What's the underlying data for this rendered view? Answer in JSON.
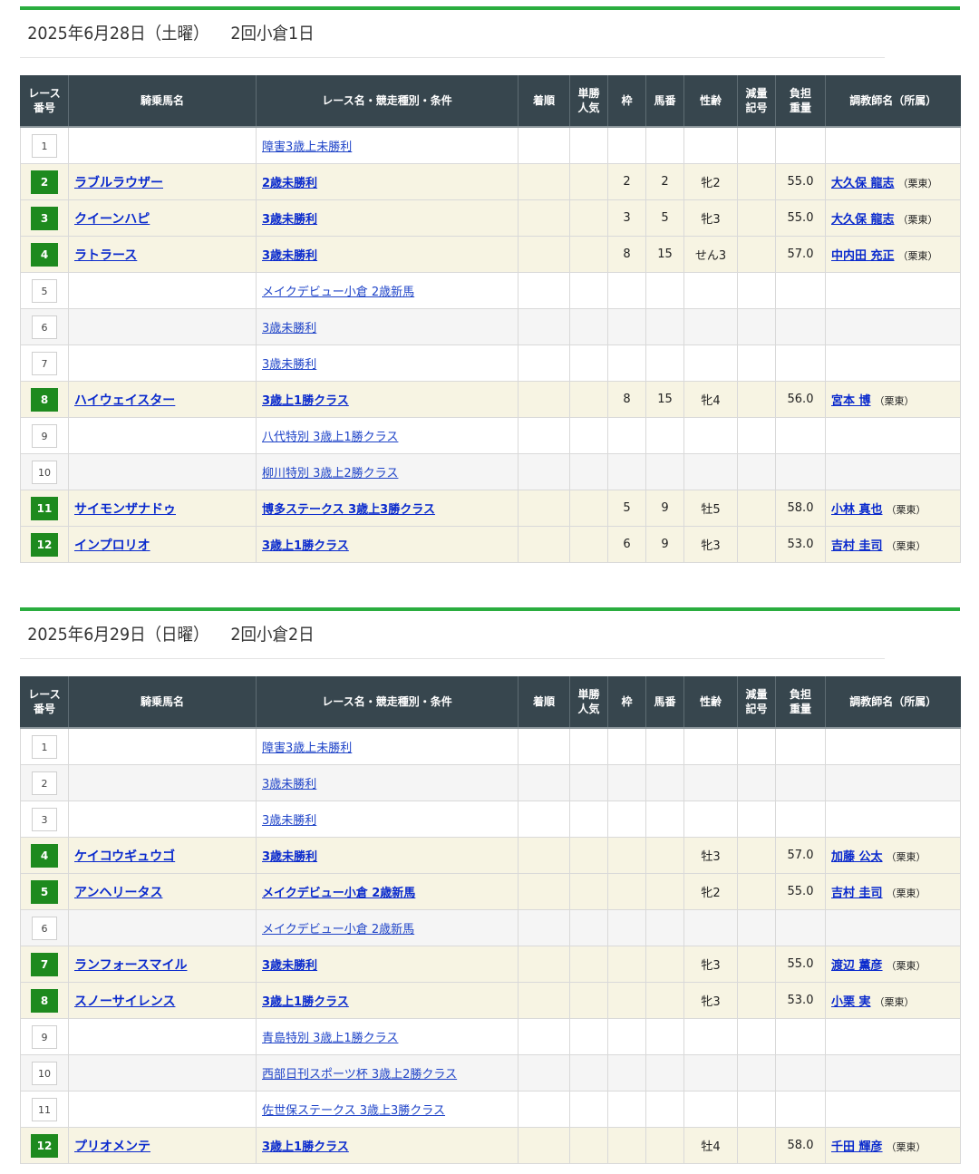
{
  "headers": {
    "race_no": [
      "レース",
      "番号"
    ],
    "jockey_horse": "騎乗馬名",
    "race_name": "レース名・競走種別・条件",
    "finish": "着順",
    "popularity": [
      "単勝",
      "人気"
    ],
    "frame": "枠",
    "horse_no": "馬番",
    "sex_age": "性齢",
    "reduction": [
      "減量",
      "記号"
    ],
    "weight": [
      "負担",
      "重量"
    ],
    "trainer": "調教師名（所属）"
  },
  "days": [
    {
      "date": "2025年6月28日（土曜）",
      "meeting": "2回小倉1日",
      "races": [
        {
          "no": "1",
          "horse": "",
          "race": "障害3歳上未勝利",
          "frame": "",
          "horse_no": "",
          "sex_age": "",
          "weight": "",
          "trainer": "",
          "affiliation": ""
        },
        {
          "no": "2",
          "horse": "ラブルラウザー",
          "race": "2歳未勝利",
          "frame": "2",
          "horse_no": "2",
          "sex_age": "牝2",
          "weight": "55.0",
          "trainer": "大久保 龍志",
          "affiliation": "（栗東）"
        },
        {
          "no": "3",
          "horse": "クイーンハピ",
          "race": "3歳未勝利",
          "frame": "3",
          "horse_no": "5",
          "sex_age": "牝3",
          "weight": "55.0",
          "trainer": "大久保 龍志",
          "affiliation": "（栗東）"
        },
        {
          "no": "4",
          "horse": "ラトラース",
          "race": "3歳未勝利",
          "frame": "8",
          "horse_no": "15",
          "sex_age": "せん3",
          "weight": "57.0",
          "trainer": "中内田 充正",
          "affiliation": "（栗東）"
        },
        {
          "no": "5",
          "horse": "",
          "race": "メイクデビュー小倉 2歳新馬",
          "frame": "",
          "horse_no": "",
          "sex_age": "",
          "weight": "",
          "trainer": "",
          "affiliation": ""
        },
        {
          "no": "6",
          "horse": "",
          "race": "3歳未勝利",
          "frame": "",
          "horse_no": "",
          "sex_age": "",
          "weight": "",
          "trainer": "",
          "affiliation": ""
        },
        {
          "no": "7",
          "horse": "",
          "race": "3歳未勝利",
          "frame": "",
          "horse_no": "",
          "sex_age": "",
          "weight": "",
          "trainer": "",
          "affiliation": ""
        },
        {
          "no": "8",
          "horse": "ハイウェイスター",
          "race": "3歳上1勝クラス",
          "frame": "8",
          "horse_no": "15",
          "sex_age": "牝4",
          "weight": "56.0",
          "trainer": "宮本 博",
          "affiliation": "（栗東）"
        },
        {
          "no": "9",
          "horse": "",
          "race": "八代特別 3歳上1勝クラス",
          "frame": "",
          "horse_no": "",
          "sex_age": "",
          "weight": "",
          "trainer": "",
          "affiliation": ""
        },
        {
          "no": "10",
          "horse": "",
          "race": "柳川特別 3歳上2勝クラス",
          "frame": "",
          "horse_no": "",
          "sex_age": "",
          "weight": "",
          "trainer": "",
          "affiliation": ""
        },
        {
          "no": "11",
          "horse": "サイモンザナドゥ",
          "race": "博多ステークス 3歳上3勝クラス",
          "frame": "5",
          "horse_no": "9",
          "sex_age": "牡5",
          "weight": "58.0",
          "trainer": "小林 真也",
          "affiliation": "（栗東）"
        },
        {
          "no": "12",
          "horse": "インプロリオ",
          "race": "3歳上1勝クラス",
          "frame": "6",
          "horse_no": "9",
          "sex_age": "牝3",
          "weight": "53.0",
          "trainer": "吉村 圭司",
          "affiliation": "（栗東）"
        }
      ]
    },
    {
      "date": "2025年6月29日（日曜）",
      "meeting": "2回小倉2日",
      "races": [
        {
          "no": "1",
          "horse": "",
          "race": "障害3歳上未勝利",
          "frame": "",
          "horse_no": "",
          "sex_age": "",
          "weight": "",
          "trainer": "",
          "affiliation": ""
        },
        {
          "no": "2",
          "horse": "",
          "race": "3歳未勝利",
          "frame": "",
          "horse_no": "",
          "sex_age": "",
          "weight": "",
          "trainer": "",
          "affiliation": ""
        },
        {
          "no": "3",
          "horse": "",
          "race": "3歳未勝利",
          "frame": "",
          "horse_no": "",
          "sex_age": "",
          "weight": "",
          "trainer": "",
          "affiliation": ""
        },
        {
          "no": "4",
          "horse": "ケイコウギュウゴ",
          "race": "3歳未勝利",
          "frame": "",
          "horse_no": "",
          "sex_age": "牡3",
          "weight": "57.0",
          "trainer": "加藤 公太",
          "affiliation": "（栗東）"
        },
        {
          "no": "5",
          "horse": "アンヘリータス",
          "race": "メイクデビュー小倉 2歳新馬",
          "frame": "",
          "horse_no": "",
          "sex_age": "牝2",
          "weight": "55.0",
          "trainer": "吉村 圭司",
          "affiliation": "（栗東）"
        },
        {
          "no": "6",
          "horse": "",
          "race": "メイクデビュー小倉 2歳新馬",
          "frame": "",
          "horse_no": "",
          "sex_age": "",
          "weight": "",
          "trainer": "",
          "affiliation": ""
        },
        {
          "no": "7",
          "horse": "ランフォースマイル",
          "race": "3歳未勝利",
          "frame": "",
          "horse_no": "",
          "sex_age": "牝3",
          "weight": "55.0",
          "trainer": "渡辺 薫彦",
          "affiliation": "（栗東）"
        },
        {
          "no": "8",
          "horse": "スノーサイレンス",
          "race": "3歳上1勝クラス",
          "frame": "",
          "horse_no": "",
          "sex_age": "牝3",
          "weight": "53.0",
          "trainer": "小栗 実",
          "affiliation": "（栗東）"
        },
        {
          "no": "9",
          "horse": "",
          "race": "青島特別 3歳上1勝クラス",
          "frame": "",
          "horse_no": "",
          "sex_age": "",
          "weight": "",
          "trainer": "",
          "affiliation": ""
        },
        {
          "no": "10",
          "horse": "",
          "race": "西部日刊スポーツ杯 3歳上2勝クラス",
          "frame": "",
          "horse_no": "",
          "sex_age": "",
          "weight": "",
          "trainer": "",
          "affiliation": ""
        },
        {
          "no": "11",
          "horse": "",
          "race": "佐世保ステークス 3歳上3勝クラス",
          "frame": "",
          "horse_no": "",
          "sex_age": "",
          "weight": "",
          "trainer": "",
          "affiliation": ""
        },
        {
          "no": "12",
          "horse": "プリオメンテ",
          "race": "3歳上1勝クラス",
          "frame": "",
          "horse_no": "",
          "sex_age": "牡4",
          "weight": "58.0",
          "trainer": "千田 輝彦",
          "affiliation": "（栗東）"
        }
      ]
    }
  ]
}
